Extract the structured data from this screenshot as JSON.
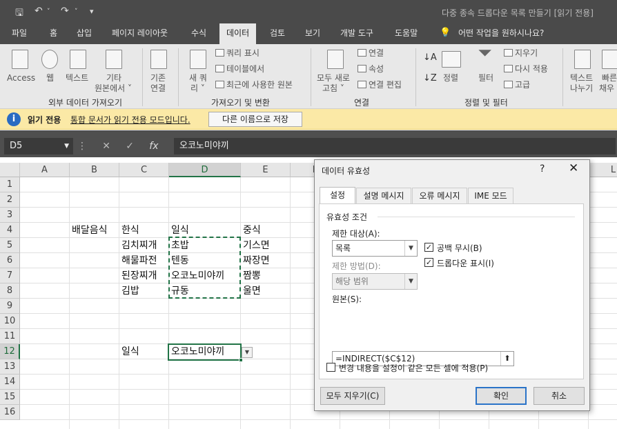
{
  "window": {
    "title": "다중 종속 드롭다운 목록 만들기  [읽기 전용]"
  },
  "quick_access": {
    "save_icon": "save-icon",
    "undo_icon": "undo-icon",
    "redo_icon": "redo-icon",
    "customize_icon": "customize-icon"
  },
  "tabs": [
    "파일",
    "홈",
    "삽입",
    "페이지 레이아웃",
    "수식",
    "데이터",
    "검토",
    "보기",
    "개발 도구",
    "도움말"
  ],
  "active_tab": "데이터",
  "tell_me": "어떤 작업을 원하시나요?",
  "ribbon": {
    "get_external": {
      "access": "Access",
      "web": "웹",
      "text": "텍스트",
      "other_1": "기타",
      "other_2": "원본에서 ˅",
      "existing_1": "기존",
      "existing_2": "연결",
      "group": "외부 데이터 가져오기"
    },
    "get_transform": {
      "new_query_1": "새 쿼",
      "new_query_2": "리 ˅",
      "show_queries": "쿼리 표시",
      "from_table": "테이블에서",
      "recent_sources": "최근에 사용한 원본",
      "group": "가져오기 및 변환"
    },
    "connections": {
      "refresh_1": "모두 새로",
      "refresh_2": "고침 ˅",
      "connections": "연결",
      "properties": "속성",
      "edit_links": "연결 편집",
      "group": "연결"
    },
    "sort_filter": {
      "sort": "정렬",
      "filter": "필터",
      "clear": "지우기",
      "reapply": "다시 적용",
      "advanced": "고급",
      "group": "정렬 및 필터"
    },
    "tools": {
      "text_to_columns_1": "텍스트",
      "text_to_columns_2": "나누기",
      "flash_1": "빠른",
      "flash_2": "채우"
    }
  },
  "message_bar": {
    "bold": "읽기 전용",
    "text": "통합 문서가 읽기 전용 모드입니다.",
    "button": "다른 이름으로 저장",
    "icon": "info-icon"
  },
  "formula_bar": {
    "name_box": "D5",
    "formula": "오코노미야끼"
  },
  "sheet": {
    "columns": [
      "A",
      "B",
      "C",
      "D",
      "E",
      "F",
      "G",
      "H",
      "I",
      "J",
      "K",
      "L"
    ],
    "selected_column": "D",
    "rows": [
      "1",
      "2",
      "3",
      "4",
      "5",
      "6",
      "7",
      "8",
      "9",
      "10",
      "11",
      "12",
      "13",
      "14",
      "15",
      "16"
    ],
    "selected_row": "12",
    "cells": {
      "B4": "배달음식",
      "C4": "한식",
      "D4": "일식",
      "E4": "중식",
      "C5": "김치찌개",
      "D5": "초밥",
      "E5": "기스면",
      "C6": "해물파전",
      "D6": "텐동",
      "E6": "짜장면",
      "C7": "된장찌개",
      "D7": "오코노미야끼",
      "E7": "짬뽕",
      "C8": "김밥",
      "D8": "규동",
      "E8": "울면",
      "C12": "일식",
      "D12": "오코노미야끼"
    }
  },
  "dialog": {
    "title": "데이터 유효성",
    "help": "?",
    "tabs": [
      "설정",
      "설명 메시지",
      "오류 메시지",
      "IME 모드"
    ],
    "active_tab": "설정",
    "section": "유효성 조건",
    "allow_label": "제한 대상(A):",
    "allow_value": "목록",
    "data_label": "제한 방법(D):",
    "data_value": "해당 범위",
    "ignore_blank": "공백 무시(B)",
    "ignore_blank_checked": true,
    "in_cell_dropdown": "드롭다운 표시(I)",
    "in_cell_dropdown_checked": true,
    "source_label": "원본(S):",
    "source_value": "=INDIRECT($C$12)",
    "apply_all": "변경 내용을 설정이 같은 모든 셀에 적용(P)",
    "apply_all_checked": false,
    "clear_all": "모두 지우기(C)",
    "ok": "확인",
    "cancel": "취소"
  }
}
